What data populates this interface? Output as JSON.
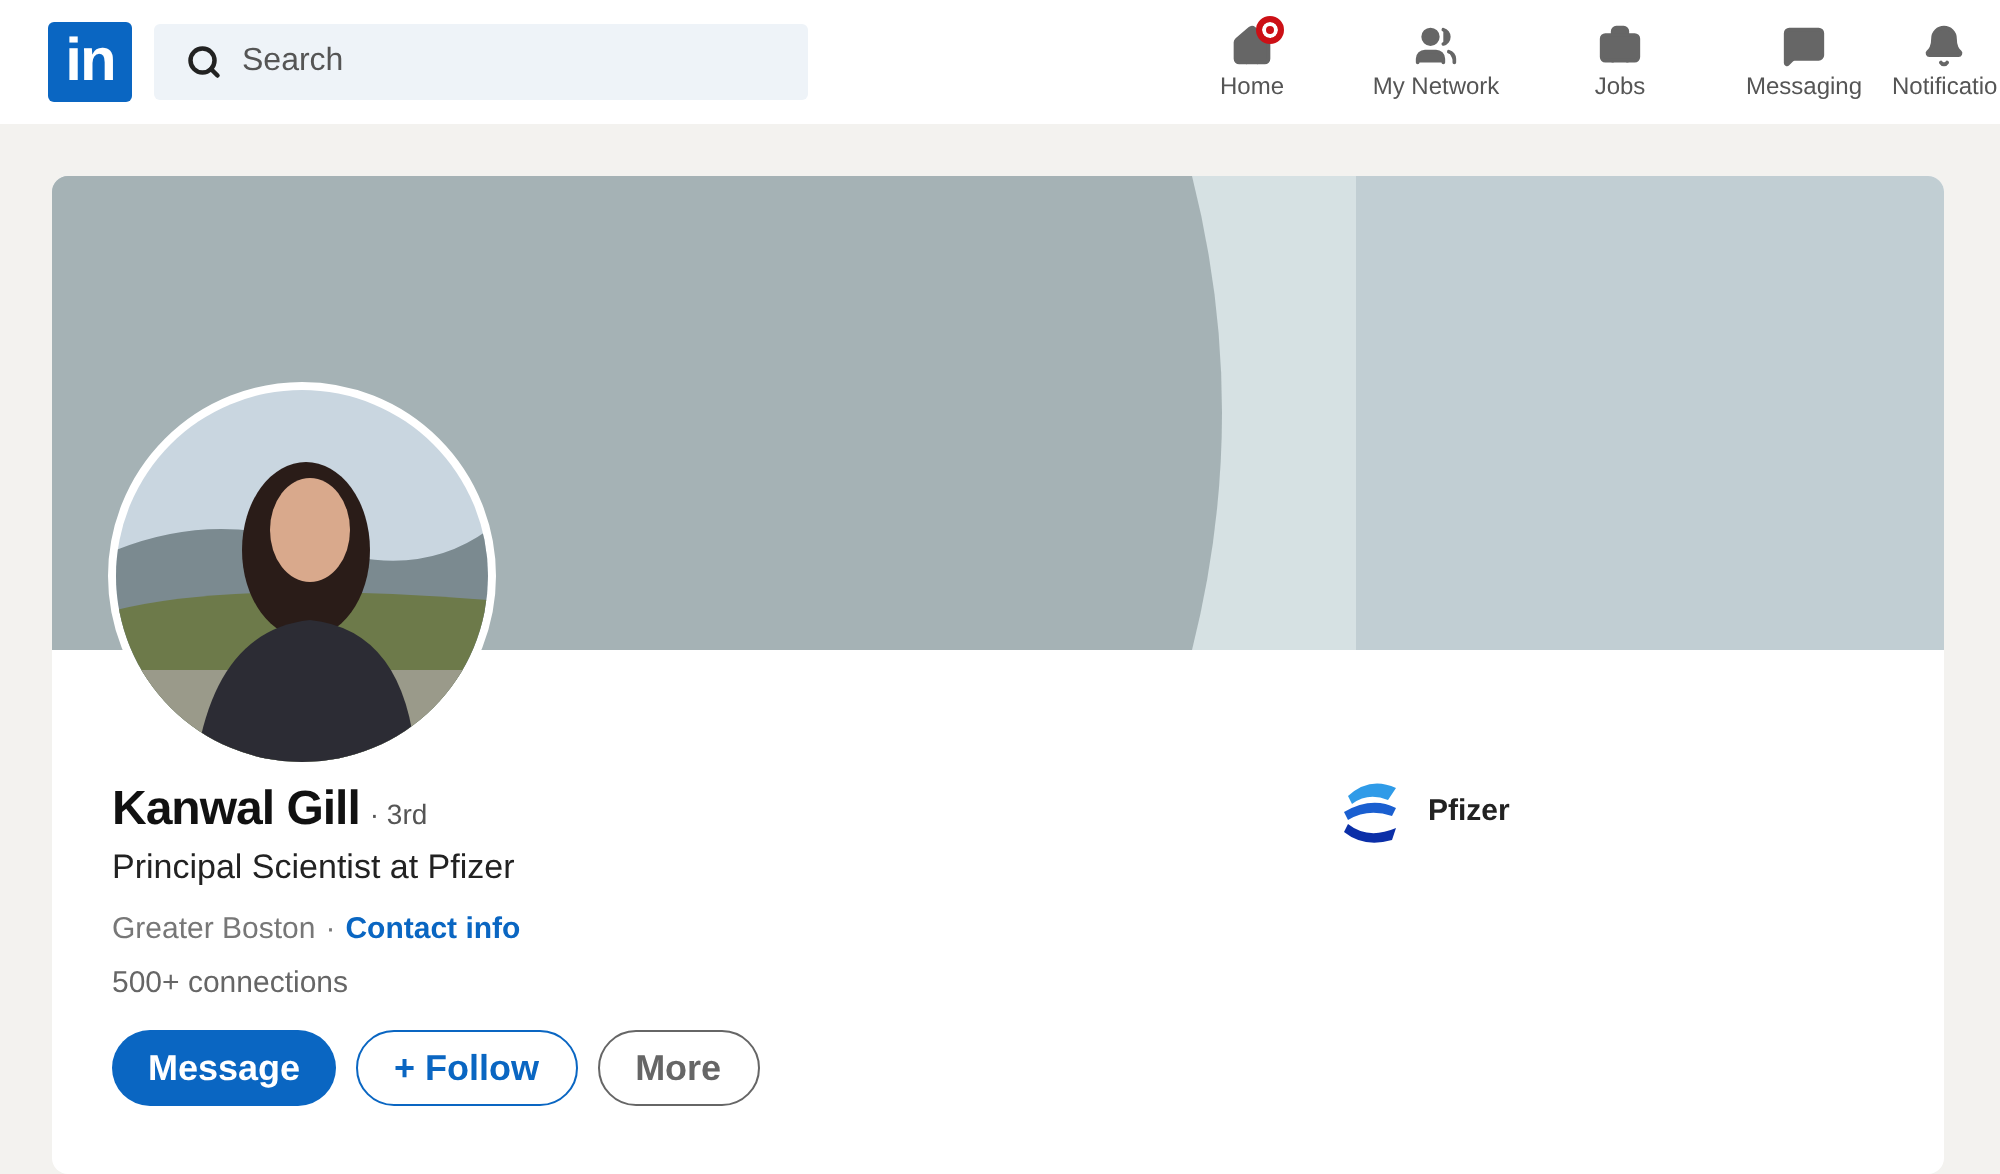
{
  "header": {
    "logo": "in",
    "search": {
      "placeholder": "Search"
    },
    "nav": [
      {
        "label": "Home",
        "badge": true
      },
      {
        "label": "My Network",
        "badge": false
      },
      {
        "label": "Jobs",
        "badge": false
      },
      {
        "label": "Messaging",
        "badge": false
      },
      {
        "label": "Notificatio",
        "badge": false
      }
    ]
  },
  "profile": {
    "name": "Kanwal Gill",
    "degree": "· 3rd",
    "headline": "Principal Scientist at Pfizer",
    "location": "Greater Boston",
    "separator": "·",
    "contact_link": "Contact info",
    "connections": "500+ connections",
    "buttons": [
      {
        "label": "Message",
        "kind": "primary"
      },
      {
        "label": "+ Follow",
        "kind": "outline"
      },
      {
        "label": "More",
        "kind": "secondary"
      }
    ],
    "company": {
      "name": "Pfizer"
    }
  }
}
